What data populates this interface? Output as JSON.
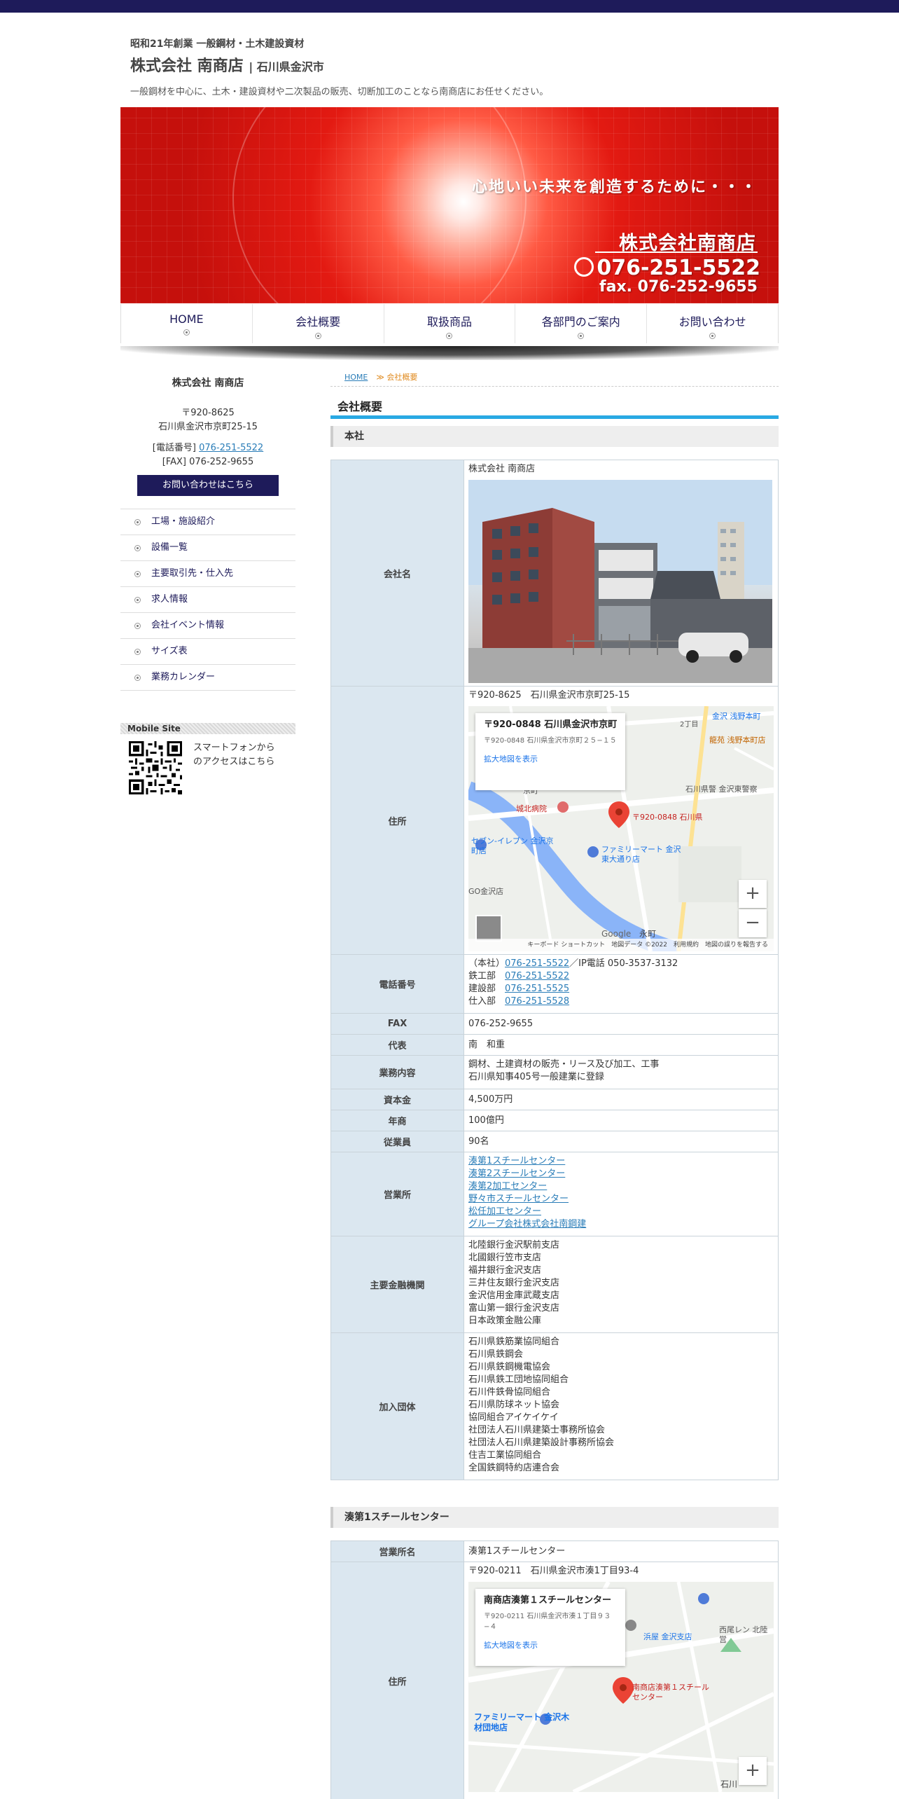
{
  "header": {
    "founded": "昭和21年創業 一般鋼材・土木建設資材",
    "company": "株式会社 南商店",
    "pref": "| 石川県金沢市",
    "description": "一般鋼材を中心に、土木・建設資材や二次製品の販売、切断加工のことなら南商店にお任せください。"
  },
  "hero": {
    "slogan": "心地いい未来を創造するために・・・",
    "name": "株式会社南商店",
    "tel": "076-251-5522",
    "fax": "fax. 076-252-9655"
  },
  "nav": [
    {
      "label": "HOME"
    },
    {
      "label": "会社概要"
    },
    {
      "label": "取扱商品"
    },
    {
      "label": "各部門のご案内"
    },
    {
      "label": "お問い合わせ"
    }
  ],
  "sidebar": {
    "name": "株式会社 南商店",
    "postal": "〒920-8625",
    "address": "石川県金沢市京町25-15",
    "tel_label": "[電話番号]",
    "tel": "076-251-5522",
    "fax": "[FAX] 076-252-9655",
    "contact_button": "お問い合わせはこちら",
    "menu": [
      {
        "label": "工場・施設紹介"
      },
      {
        "label": "設備一覧"
      },
      {
        "label": "主要取引先・仕入先"
      },
      {
        "label": "求人情報"
      },
      {
        "label": "会社イベント情報"
      },
      {
        "label": "サイズ表"
      },
      {
        "label": "業務カレンダー"
      }
    ],
    "mobile_title": "Mobile Site",
    "mobile_text1": "スマートフォンから",
    "mobile_text2": "のアクセスはこちら"
  },
  "breadcrumb": {
    "home": "HOME",
    "current": "≫ 会社概要"
  },
  "page_title": "会社概要",
  "section1": {
    "title": "本社",
    "company_label": "会社名",
    "company_value": "株式会社 南商店",
    "address_label": "住所",
    "address_value": "〒920-8625　石川県金沢市京町25-15",
    "map": {
      "card_title": "〒920-0848 石川県金沢市京町...",
      "card_addr": "〒920-0848 石川県金沢市京町２５−１５",
      "card_link": "拡大地図を表示",
      "pin_label": "〒920-0848 石川県",
      "labels": [
        "金沢 浅野本町",
        "2丁目",
        "龍苑 浅野本町店",
        "石川県警 金沢東警察",
        "城北病院",
        "京町",
        "セブン-イレブン 金沢京町店",
        "ファミリーマート 金沢東大通り店",
        "GO金沢店",
        "Google",
        "永町"
      ],
      "footer": "キーボード ショートカット　地図データ ©2022　利用規約　地図の誤りを報告する"
    },
    "phone_label": "電話番号",
    "phone_lines": [
      {
        "prefix": "（本社）",
        "number": "076-251-5522",
        "suffix": "／IP電話 050-3537-3132"
      },
      {
        "prefix": "鉄工部　",
        "number": "076-251-5522",
        "suffix": ""
      },
      {
        "prefix": "建設部　",
        "number": "076-251-5525",
        "suffix": ""
      },
      {
        "prefix": "仕入部　",
        "number": "076-251-5528",
        "suffix": ""
      }
    ],
    "fax_label": "FAX",
    "fax_value": "076-252-9655",
    "rep_label": "代表",
    "rep_value": "南　和重",
    "business_label": "業務内容",
    "business_lines": [
      "鋼材、土建資材の販売・リース及び加工、工事",
      "石川県知事405号一般建業に登録"
    ],
    "capital_label": "資本金",
    "capital_value": "4,500万円",
    "sales_label": "年商",
    "sales_value": "100億円",
    "employees_label": "従業員",
    "employees_value": "90名",
    "offices_label": "営業所",
    "offices": [
      "湊第1スチールセンター",
      "湊第2スチールセンター",
      "湊第2加工センター",
      "野々市スチールセンター",
      "松任加工センター",
      "グループ会社株式会社南鋼建"
    ],
    "banks_label": "主要金融機関",
    "banks": [
      "北陸銀行金沢駅前支店",
      "北國銀行笠市支店",
      "福井銀行金沢支店",
      "三井住友銀行金沢支店",
      "金沢信用金庫武蔵支店",
      "富山第一銀行金沢支店",
      "日本政策金融公庫"
    ],
    "groups_label": "加入団体",
    "groups": [
      "石川県鉄筋業協同組合",
      "石川県鉄鋼会",
      "石川県鉄鋼機電協会",
      "石川県鉄工団地協同組合",
      "石川件鉄骨協同組合",
      "石川県防球ネット協会",
      "協同組合アイケイケイ",
      "社団法人石川県建築士事務所協会",
      "社団法人石川県建築設計事務所協会",
      "住吉工業協同組合",
      "全国鉄鋼特約店連合会"
    ]
  },
  "section2": {
    "title": "湊第1スチールセンター",
    "office_label": "営業所名",
    "office_value": "湊第1スチールセンター",
    "address_label": "住所",
    "address_value": "〒920-0211　石川県金沢市湊1丁目93-4",
    "map": {
      "card_title": "南商店湊第１スチールセンター",
      "card_addr": "〒920-0211 石川県金沢市湊１丁目９３−４",
      "card_link": "拡大地図を表示",
      "pin_label": "南商店湊第１スチールセンター",
      "labels": [
        "浜屋 金沢支店",
        "西尾レン 北陸営",
        "ファミリーマート 金沢木材団地店",
        "石川"
      ]
    }
  }
}
